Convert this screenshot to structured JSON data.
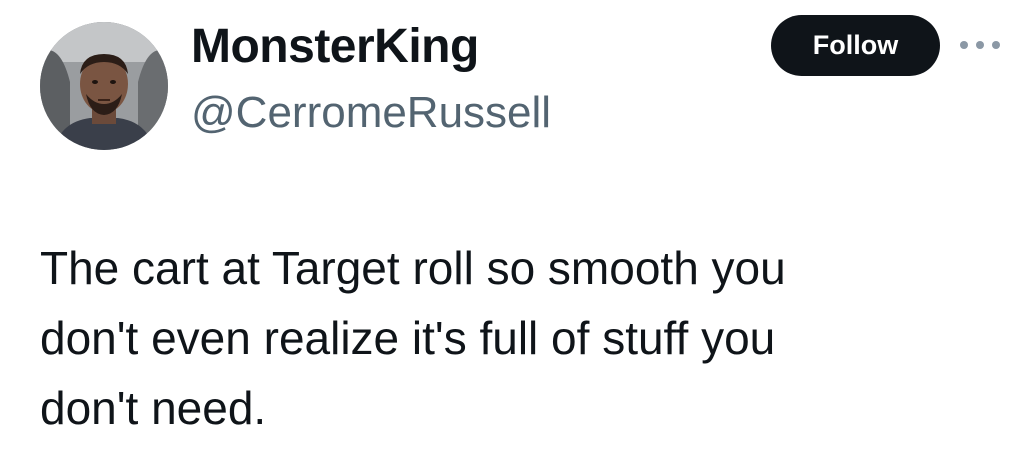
{
  "author": {
    "display_name": "MonsterKing",
    "handle": "@CerromeRussell"
  },
  "actions": {
    "follow_label": "Follow",
    "more_icon": "more-horizontal-icon"
  },
  "tweet": {
    "lines": [
      "The cart at Target roll so smooth you",
      "don't even realize it's full of stuff you",
      "don't need."
    ]
  },
  "colors": {
    "text": "#0f1419",
    "secondary_text": "#536471",
    "follow_button_bg": "#0f1419",
    "follow_button_text": "#ffffff",
    "background": "#ffffff"
  }
}
